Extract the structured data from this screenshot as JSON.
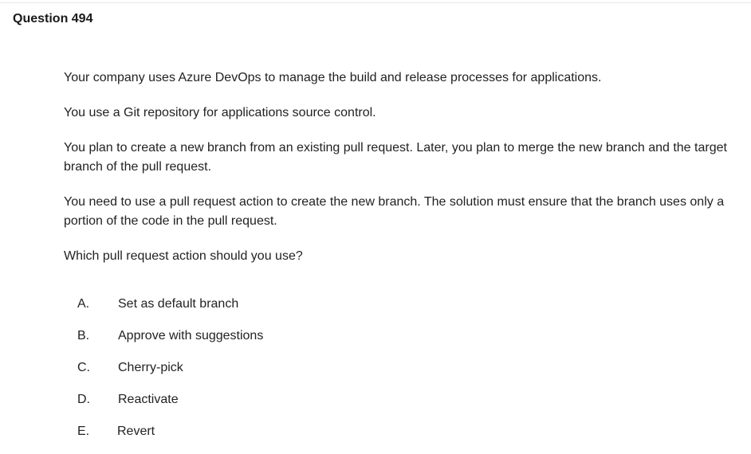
{
  "question": {
    "title": "Question 494",
    "paragraphs": [
      "Your company uses Azure DevOps to manage the build and release processes for applications.",
      "You use a Git repository for applications source control.",
      "You plan to create a new branch from an existing pull request. Later, you plan to merge the new branch and the target branch of the pull request.",
      "You need to use a pull request action to create the new branch. The solution must ensure that the branch uses only a portion of the code in the pull request.",
      "Which pull request action should you use?"
    ],
    "options": [
      {
        "letter": "A.",
        "text": "Set as default branch"
      },
      {
        "letter": "B.",
        "text": "Approve with suggestions"
      },
      {
        "letter": "C.",
        "text": "Cherry-pick"
      },
      {
        "letter": "D.",
        "text": "Reactivate"
      },
      {
        "letter": "E.",
        "text": "Revert"
      }
    ]
  }
}
